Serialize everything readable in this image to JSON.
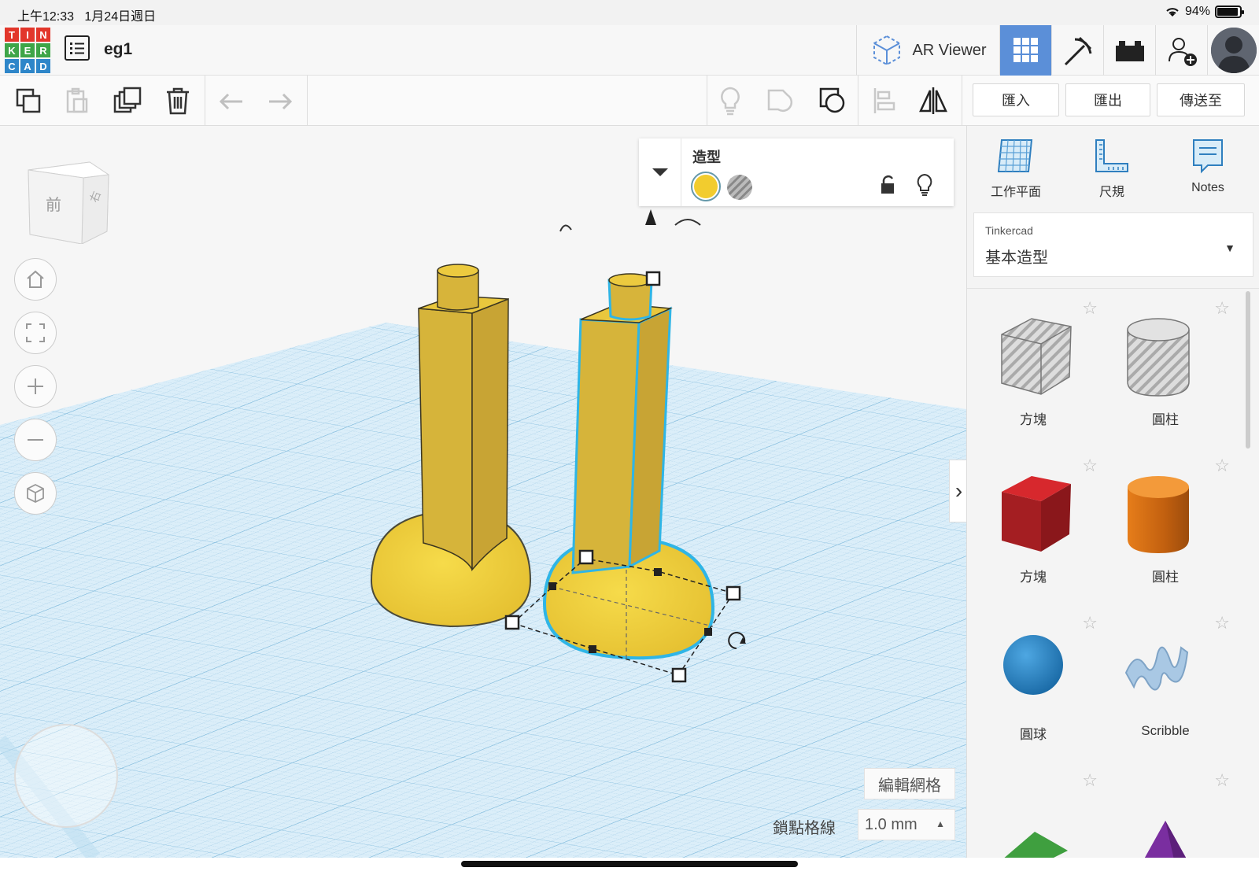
{
  "status": {
    "time": "上午12:33",
    "date": "1月24日週日",
    "battery": "94%"
  },
  "logo": [
    "T",
    "I",
    "N",
    "K",
    "E",
    "R",
    "C",
    "A",
    "D"
  ],
  "document": {
    "title": "eg1"
  },
  "nav": {
    "ar_viewer": "AR Viewer",
    "icons": [
      "grid-view-icon",
      "pickaxe-icon",
      "bricks-icon",
      "add-user-icon"
    ]
  },
  "toolbar": {
    "import": "匯入",
    "export": "匯出",
    "send_to": "傳送至"
  },
  "viewcube": {
    "front": "前",
    "right": "右"
  },
  "shape_panel": {
    "title": "造型"
  },
  "workspace": {
    "edit_grid": "編輯網格",
    "snap_label": "鎖點格線",
    "snap_value": "1.0 mm"
  },
  "side_panel": {
    "tools": [
      {
        "label": "工作平面",
        "icon": "workplane-icon"
      },
      {
        "label": "尺規",
        "icon": "ruler-icon"
      },
      {
        "label": "Notes",
        "icon": "notes-icon"
      }
    ],
    "library_source": "Tinkercad",
    "library_name": "基本造型",
    "shapes": [
      {
        "label": "方塊",
        "kind": "box-hole"
      },
      {
        "label": "圓柱",
        "kind": "cylinder-hole"
      },
      {
        "label": "方塊",
        "kind": "box"
      },
      {
        "label": "圓柱",
        "kind": "cylinder"
      },
      {
        "label": "圓球",
        "kind": "sphere"
      },
      {
        "label": "Scribble",
        "kind": "scribble"
      }
    ]
  },
  "colors": {
    "accent": "#5b8fd8",
    "shape_yellow": "#f2cc2e",
    "grid_blue": "#cfe6f4"
  }
}
